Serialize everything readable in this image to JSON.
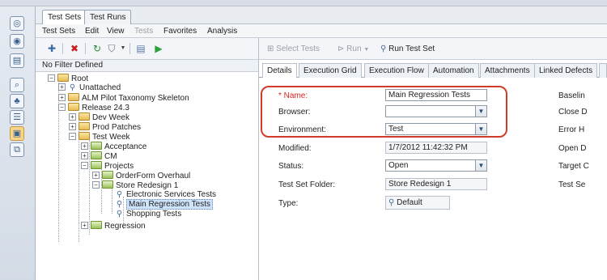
{
  "module_tabs": [
    "Test Sets",
    "Test Runs"
  ],
  "menu": {
    "items": [
      "Test Sets",
      "Edit",
      "View",
      "Tests",
      "Favorites",
      "Analysis"
    ]
  },
  "filter": {
    "text": "No Filter Defined"
  },
  "tree": {
    "root": "Root",
    "unattached": "Unattached",
    "alm_pilot": "ALM Pilot Taxonomy Skeleton",
    "release": "Release 24.3",
    "dev_week": "Dev Week",
    "prod_patches": "Prod Patches",
    "test_week": "Test Week",
    "acceptance": "Acceptance",
    "cm": "CM",
    "projects": "Projects",
    "orderform": "OrderForm Overhaul",
    "store_redesign": "Store Redesign 1",
    "electronic": "Electronic Services Tests",
    "main_regression": "Main Regression Tests",
    "shopping": "Shopping Tests",
    "regression": "Regression"
  },
  "right_toolbar": {
    "select_tests": "Select Tests",
    "run": "Run",
    "run_test_set": "Run Test Set"
  },
  "detail_tabs": [
    "Details",
    "Execution Grid",
    "Execution Flow",
    "Automation",
    "Attachments",
    "Linked Defects"
  ],
  "form": {
    "name_label": "* Name:",
    "name_value": "Main Regression Tests",
    "browser_label": "Browser:",
    "browser_value": "",
    "environment_label": "Environment:",
    "environment_value": "Test",
    "modified_label": "Modified:",
    "modified_value": "1/7/2012 11:42:32 PM",
    "status_label": "Status:",
    "status_value": "Open",
    "folder_label": "Test Set Folder:",
    "folder_value": "Store Redesign 1",
    "type_label": "Type:",
    "type_value": "Default"
  },
  "right_col": [
    "Baselin",
    "Close D",
    "Error H",
    "Open D",
    "Target C",
    "Test Se"
  ],
  "colors": {
    "highlight": "#d03c2a",
    "selection": "#cfe3fb"
  }
}
